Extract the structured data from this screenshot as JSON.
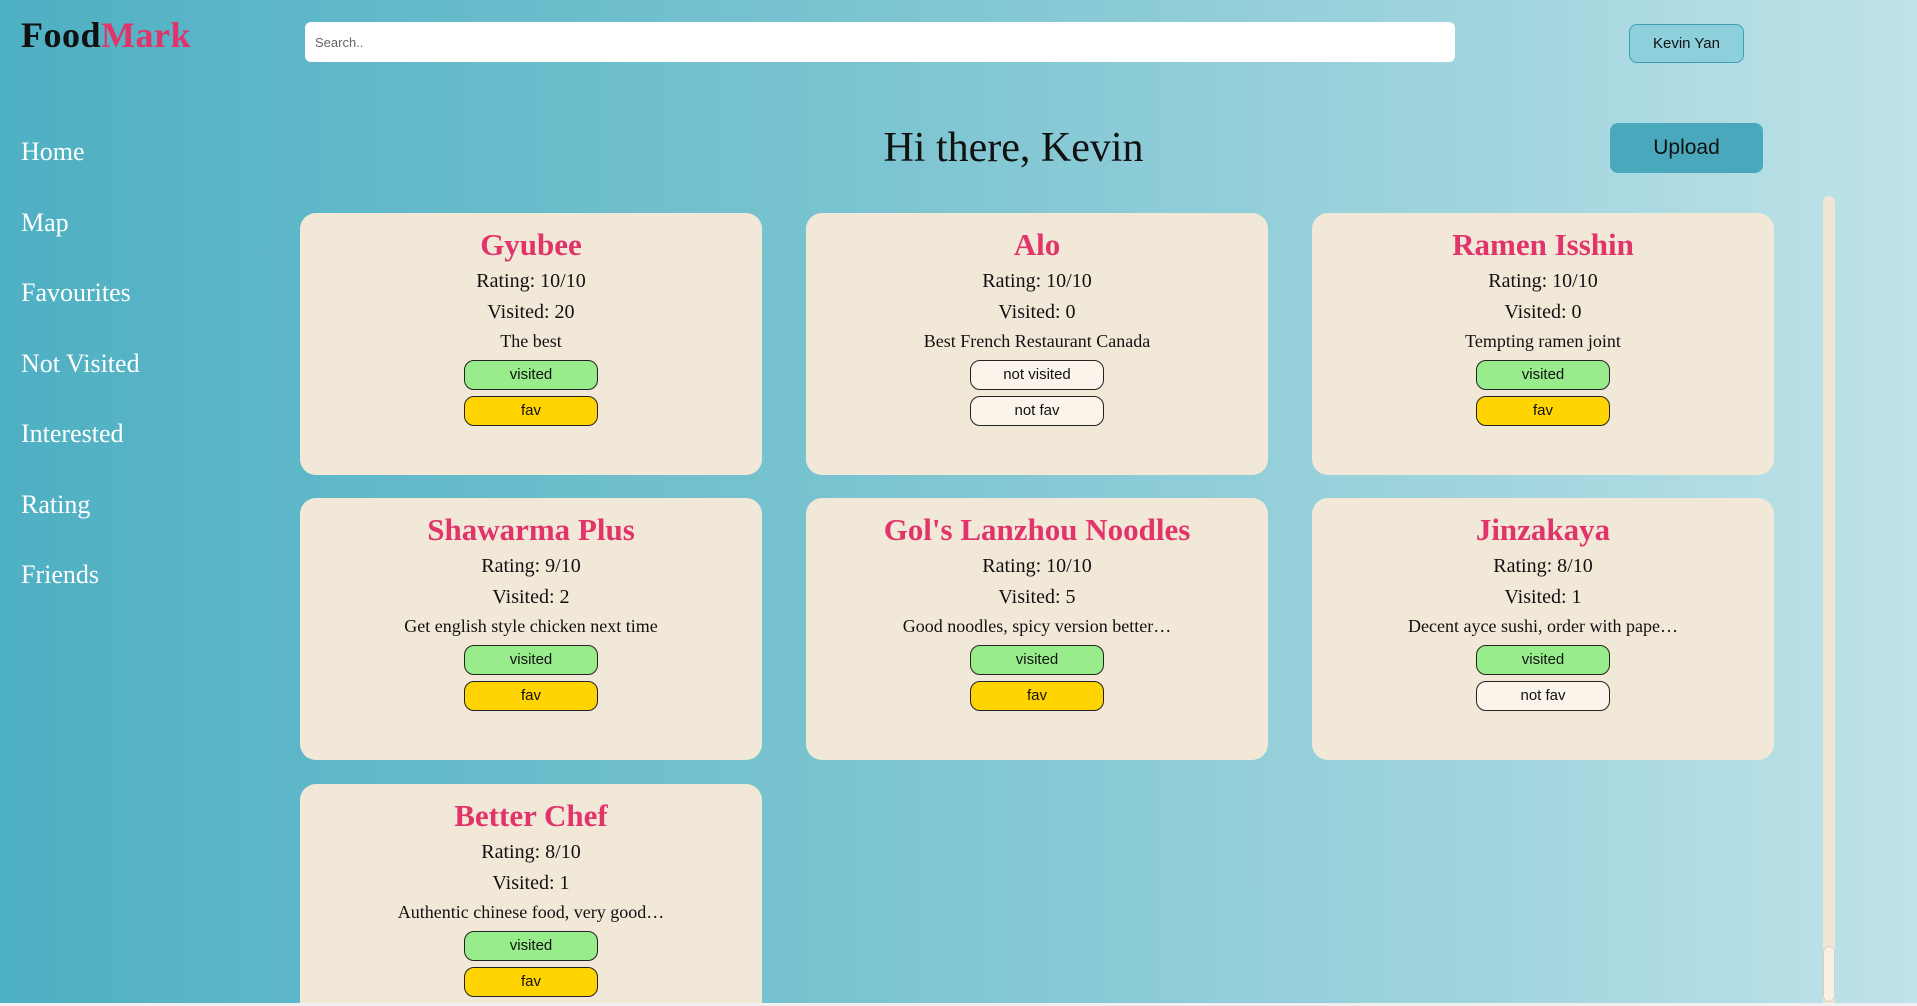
{
  "logo": {
    "part1": "Food",
    "part2": "Mark"
  },
  "search": {
    "placeholder": "Search.."
  },
  "user": {
    "name": "Kevin Yan"
  },
  "nav": {
    "items": [
      "Home",
      "Map",
      "Favourites",
      "Not Visited",
      "Interested",
      "Rating",
      "Friends"
    ]
  },
  "greeting": {
    "text": "Hi there, Kevin"
  },
  "upload": {
    "label": "Upload"
  },
  "restaurants": [
    {
      "name": "Gyubee",
      "rating": "Rating: 10/10",
      "visited_count": "Visited: 20",
      "desc": "The best",
      "visited": "visited",
      "fav": "fav",
      "visited_state": true,
      "fav_state": true
    },
    {
      "name": "Alo",
      "rating": "Rating: 10/10",
      "visited_count": "Visited: 0",
      "desc": "Best French Restaurant Canada",
      "visited": "not visited",
      "fav": "not fav",
      "visited_state": false,
      "fav_state": false
    },
    {
      "name": "Ramen Isshin",
      "rating": "Rating: 10/10",
      "visited_count": "Visited: 0",
      "desc": "Tempting ramen joint",
      "visited": "visited",
      "fav": "fav",
      "visited_state": true,
      "fav_state": true
    },
    {
      "name": "Shawarma Plus",
      "rating": "Rating: 9/10",
      "visited_count": "Visited: 2",
      "desc": "Get english style chicken next time",
      "visited": "visited",
      "fav": "fav",
      "visited_state": true,
      "fav_state": true
    },
    {
      "name": "Gol's Lanzhou Noodles",
      "rating": "Rating: 10/10",
      "visited_count": "Visited: 5",
      "desc": "Good noodles, spicy version better…",
      "visited": "visited",
      "fav": "fav",
      "visited_state": true,
      "fav_state": true
    },
    {
      "name": "Jinzakaya",
      "rating": "Rating: 8/10",
      "visited_count": "Visited: 1",
      "desc": "Decent ayce sushi, order with pape…",
      "visited": "visited",
      "fav": "not fav",
      "visited_state": true,
      "fav_state": false
    },
    {
      "name": "Better Chef",
      "rating": "Rating: 8/10",
      "visited_count": "Visited: 1",
      "desc": "Authentic chinese food, very good…",
      "visited": "visited",
      "fav": "fav",
      "visited_state": true,
      "fav_state": true
    }
  ],
  "colors": {
    "accent": "#e0346a",
    "card": "#f1e8d8",
    "visited": "#98ec8c",
    "fav": "#ffd400",
    "button": "#4aa8bd"
  }
}
